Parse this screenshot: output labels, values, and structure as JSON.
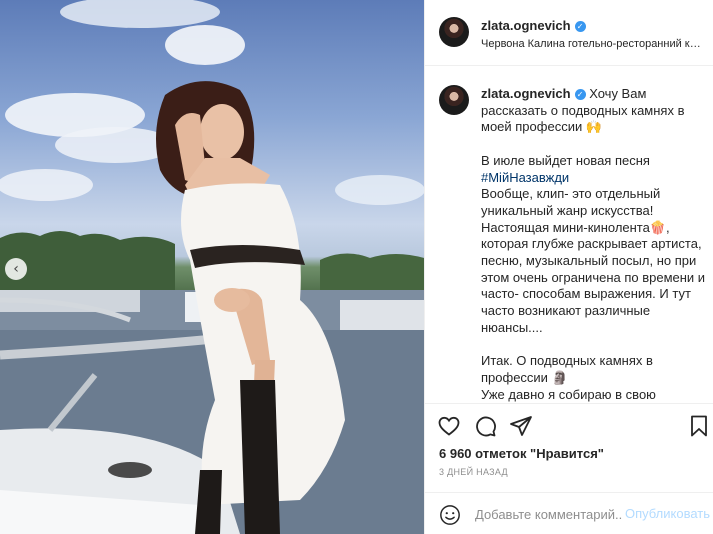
{
  "post": {
    "username": "zlata.ognevich",
    "location": "Червона Калина готельно-ресторанний комплекс",
    "caption": {
      "intro": "Хочу Вам рассказать о подводных камнях в моей профессии 🙌",
      "p2_text": "В июле выйдет новая песня",
      "p2_hashtag": "#МійНазавжди",
      "p2_rest": "Вообще, клип- это отдельный уникальный жанр искусства! Настоящая мини-кинолента🍿, которая глубже раскрывает артиста, песню, музыкальный посыл, но при этом очень ограничена по времени и часто- способам выражения. И тут часто возникают различные нюансы....",
      "p3": "Итак. О подводных камнях в профессии 🗿",
      "p4": "Уже давно я собираю в свою актёрскую копилку эмоции, чтобы в"
    },
    "likes": "6 960 отметок \"Нравится\"",
    "time": "3 ДНЕЙ НАЗАД",
    "comment_placeholder": "Добавьте комментарий...",
    "publish_label": "Опубликовать"
  },
  "icons": {
    "verified": "verified-badge-icon",
    "like": "heart-icon",
    "comment": "comment-bubble-icon",
    "share": "paper-plane-icon",
    "save": "bookmark-icon",
    "emoji": "smiley-icon",
    "carousel_prev": "chevron-left-icon"
  },
  "colors": {
    "username": "#262626",
    "hashtag": "#003569",
    "verified": "#3897f0",
    "publish_disabled": "#b3dbff",
    "secondary_text": "#8e8e8e"
  }
}
